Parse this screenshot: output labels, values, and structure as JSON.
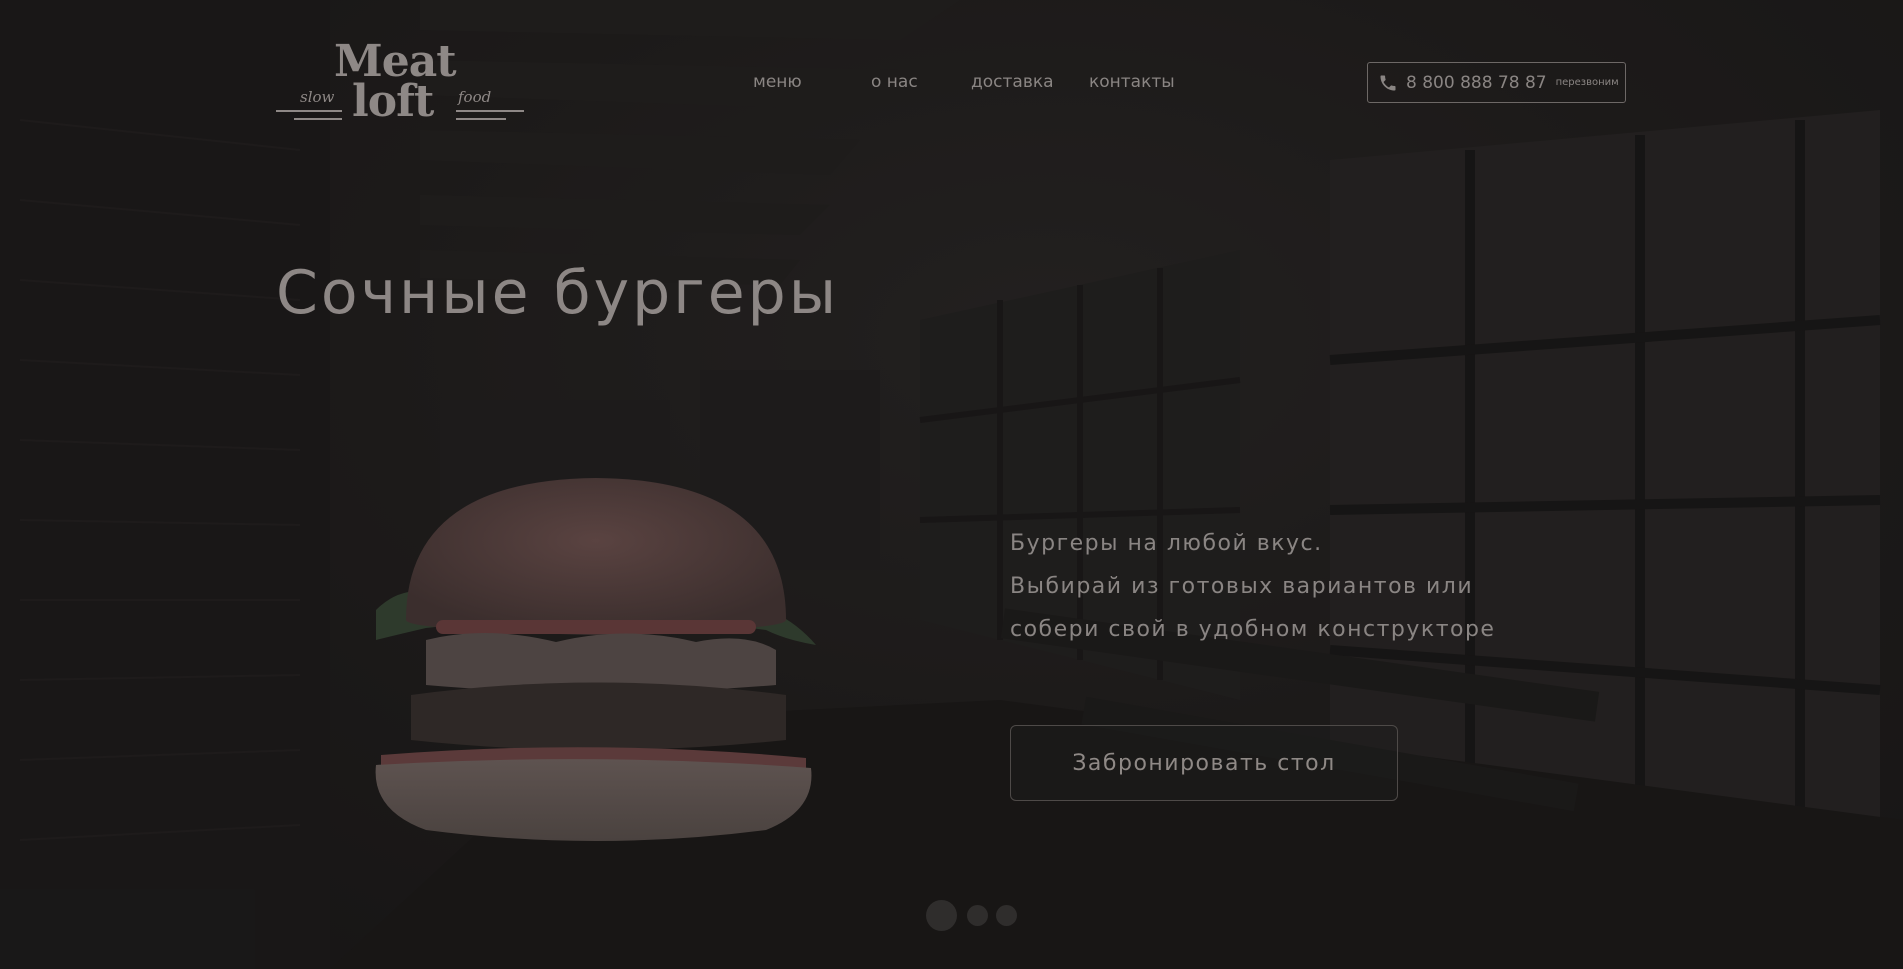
{
  "brand": {
    "logo_line1": "Meat",
    "logo_line2": "loft",
    "logo_left": "slow",
    "logo_right": "food"
  },
  "nav": {
    "items": [
      {
        "label": "меню"
      },
      {
        "label": "о нас"
      },
      {
        "label": "доставка"
      },
      {
        "label": "контакты"
      }
    ]
  },
  "contact": {
    "phone": "8 800 888 78 87",
    "callback_label": "перезвоним",
    "icon": "phone-icon"
  },
  "hero": {
    "title": "Сочные бургеры",
    "description_lines": [
      "Бургеры на любой вкус.",
      "Выбирай из готовых вариантов или",
      "собери свой в удобном конструкторе"
    ],
    "cta_label": "Забронировать стол"
  },
  "slider": {
    "count": 3,
    "active_index": 0
  },
  "colors": {
    "background": "#1b1a1a",
    "text": "#8a8583",
    "border": "#6d6866"
  }
}
